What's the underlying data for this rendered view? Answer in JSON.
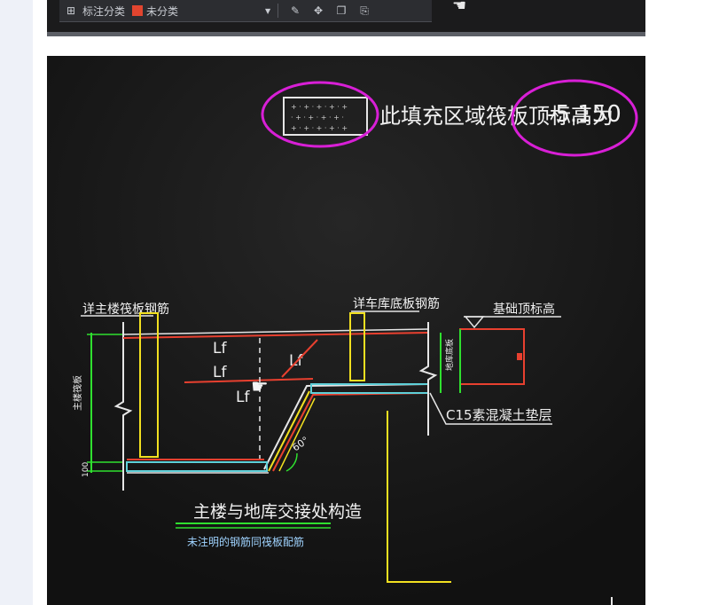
{
  "toolbar": {
    "label": "标注分类",
    "category": "未分类",
    "category_color": "#e2452f"
  },
  "drawing": {
    "legend_text": "此填充区域筏板顶标高为",
    "elevation": "-5.150",
    "label_main_rebar": "详主楼筏板钢筋",
    "label_garage_rebar": "详车库底板钢筋",
    "label_foundation": "基础顶标高",
    "label_cushion": "C15素混凝土垫层",
    "title": "主楼与地库交接处构造",
    "subtitle": "未注明的钢筋同筏板配筋",
    "lf": "Lf",
    "angle": "60°",
    "dim_100": "100",
    "dim_vertical": "主楼筏板",
    "dim_vertical_right": "地库底板",
    "annotation_color": "#d81fd6"
  }
}
